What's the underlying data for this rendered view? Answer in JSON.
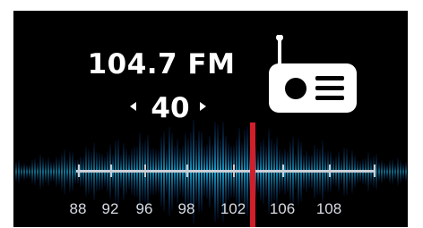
{
  "station": {
    "frequency_text": "104.7 FM",
    "step_value": "40"
  },
  "scale": {
    "labels": [
      "88",
      "92",
      "96",
      "98",
      "102",
      "106",
      "108"
    ],
    "needle_color": "#d01f2a",
    "wave_color": "#1aa7d6"
  },
  "icons": {
    "radio": "radio-icon",
    "prev": "chevron-left-icon",
    "next": "chevron-right-icon"
  }
}
